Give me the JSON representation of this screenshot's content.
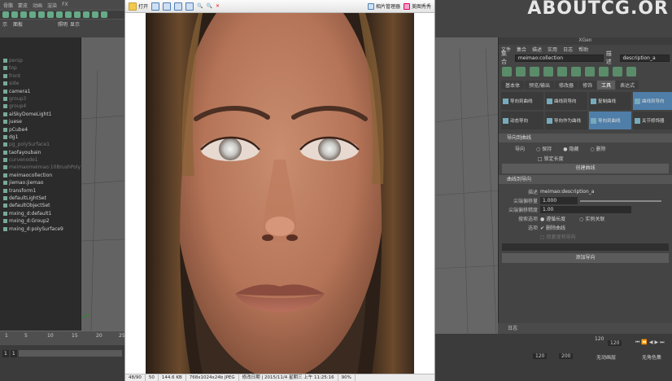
{
  "left_menu": [
    "",
    "",
    "",
    "骨骼",
    "蒙皮",
    "",
    "动画",
    "渲染",
    "FX"
  ],
  "left_panel_tabs": [
    "示",
    "面板"
  ],
  "viewport_tabs": [
    "照明",
    "显示",
    "渲染器"
  ],
  "outliner_items": [
    {
      "label": "persp",
      "dim": true
    },
    {
      "label": "top",
      "dim": true
    },
    {
      "label": "front",
      "dim": true
    },
    {
      "label": "side",
      "dim": true
    },
    {
      "label": "camera1",
      "dim": false
    },
    {
      "label": "group3",
      "dim": true
    },
    {
      "label": "group4",
      "dim": true
    },
    {
      "label": "aiSkyDomeLight1",
      "dim": false
    },
    {
      "label": "juese",
      "dim": false
    },
    {
      "label": "pCube4",
      "dim": false
    },
    {
      "label": "dg1",
      "dim": false
    },
    {
      "label": "pg_polySurface1",
      "dim": true
    },
    {
      "label": "taofayoubain",
      "dim": false
    },
    {
      "label": "curvenode1",
      "dim": true
    },
    {
      "label": "meimaomeimao:10BrushPolyMe",
      "dim": true
    },
    {
      "label": "meimaocollection",
      "dim": false
    },
    {
      "label": "jiemao:jiemao",
      "dim": false
    },
    {
      "label": "transform1",
      "dim": false
    },
    {
      "label": "defaultLightSet",
      "dim": false
    },
    {
      "label": "defaultObjectSet",
      "dim": false
    },
    {
      "label": "mxing_d:default1",
      "dim": false
    },
    {
      "label": "mxing_d:Group2",
      "dim": false
    },
    {
      "label": "mxing_d:polySurface9",
      "dim": false
    }
  ],
  "timeline_ticks": [
    "1",
    "5",
    "10",
    "15",
    "20",
    "25"
  ],
  "range_start": "1",
  "range_current": "1",
  "viewer_toolbar": {
    "open": "打开",
    "photo_manager": "相片管理器",
    "wallpaper": "壁纸",
    "extra": "美图秀秀"
  },
  "viewer_status": [
    "48/90",
    "50",
    "144.6 KB",
    "768x1024x24b JPEG",
    "修改日期 | 2015/11/4 星期三 上午 11:25:16",
    "90%"
  ],
  "logo": "ABOUTCG.OR",
  "xgen": {
    "title": "XGen",
    "menu": [
      "文件",
      "集合",
      "描述",
      "实用",
      "日志",
      "帮助"
    ],
    "collection_label": "集合",
    "collection_value": "meimao:collection",
    "description_label": "描述",
    "description_value": "description_a",
    "tabs": [
      "基本体",
      "预览/输出",
      "修改器",
      "修饰",
      "工具",
      "表达式"
    ],
    "active_tab": "工具",
    "tools": [
      {
        "label": "导向到曲线",
        "on": false
      },
      {
        "label": "曲线到导向",
        "on": false
      },
      {
        "label": "复制曲线",
        "on": false
      },
      {
        "label": "曲线到导向",
        "on": true
      },
      {
        "label": "动态导向",
        "on": false
      },
      {
        "label": "导向作为曲线",
        "on": false
      },
      {
        "label": "导向到曲线",
        "on": true
      },
      {
        "label": "关节修饰器",
        "on": false
      }
    ],
    "section1": "导向到曲线",
    "direction_label": "导向",
    "radio_options": [
      "保持",
      "隐藏",
      "删除"
    ],
    "lock_length": "锁定长度",
    "create_curves": "创建曲线",
    "section2": "曲线到导向",
    "desc_field_label": "描述",
    "desc_field_value": "meimao:description_a",
    "tip_label": "尖端偏移量",
    "tip_value": "1.000",
    "tip_precision_label": "尖端偏移精度",
    "tip_precision_value": "1.00",
    "search_label": "搜索选项",
    "search_option1": "遵循长度",
    "search_option2": "实例关联",
    "options_label": "选项",
    "option_delete": "删除曲线",
    "option_lock": "修复现有导向",
    "add_guides": "添加导向",
    "log_label": "日志"
  },
  "right_ticks": [
    "120",
    "120"
  ],
  "right_ranges": [
    "120",
    "200"
  ],
  "anim_layer": "无动画层",
  "char_set": "无角色集"
}
